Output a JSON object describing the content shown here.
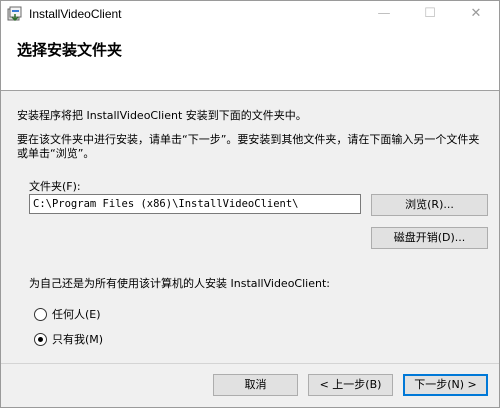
{
  "window": {
    "title": "InstallVideoClient",
    "minimize_glyph": "—",
    "maximize_glyph": "☐",
    "close_glyph": "✕",
    "icon": "installer-icon"
  },
  "header": {
    "title": "选择安装文件夹"
  },
  "body": {
    "line1": "安装程序将把 InstallVideoClient 安装到下面的文件夹中。",
    "line2": "要在该文件夹中进行安装，请单击“下一步”。要安装到其他文件夹，请在下面输入另一个文件夹或单击“浏览”。"
  },
  "folder": {
    "label": "文件夹(F):",
    "value": "C:\\Program Files (x86)\\InstallVideoClient\\"
  },
  "buttons": {
    "browse": "浏览(R)...",
    "disk_cost": "磁盘开销(D)...",
    "cancel": "取消",
    "back": "< 上一步(B)",
    "next": "下一步(N) >"
  },
  "install_for": {
    "label": "为自己还是为所有使用该计算机的人安装 InstallVideoClient:",
    "options": [
      {
        "label": "任何人(E)",
        "checked": false
      },
      {
        "label": "只有我(M)",
        "checked": true
      }
    ]
  }
}
